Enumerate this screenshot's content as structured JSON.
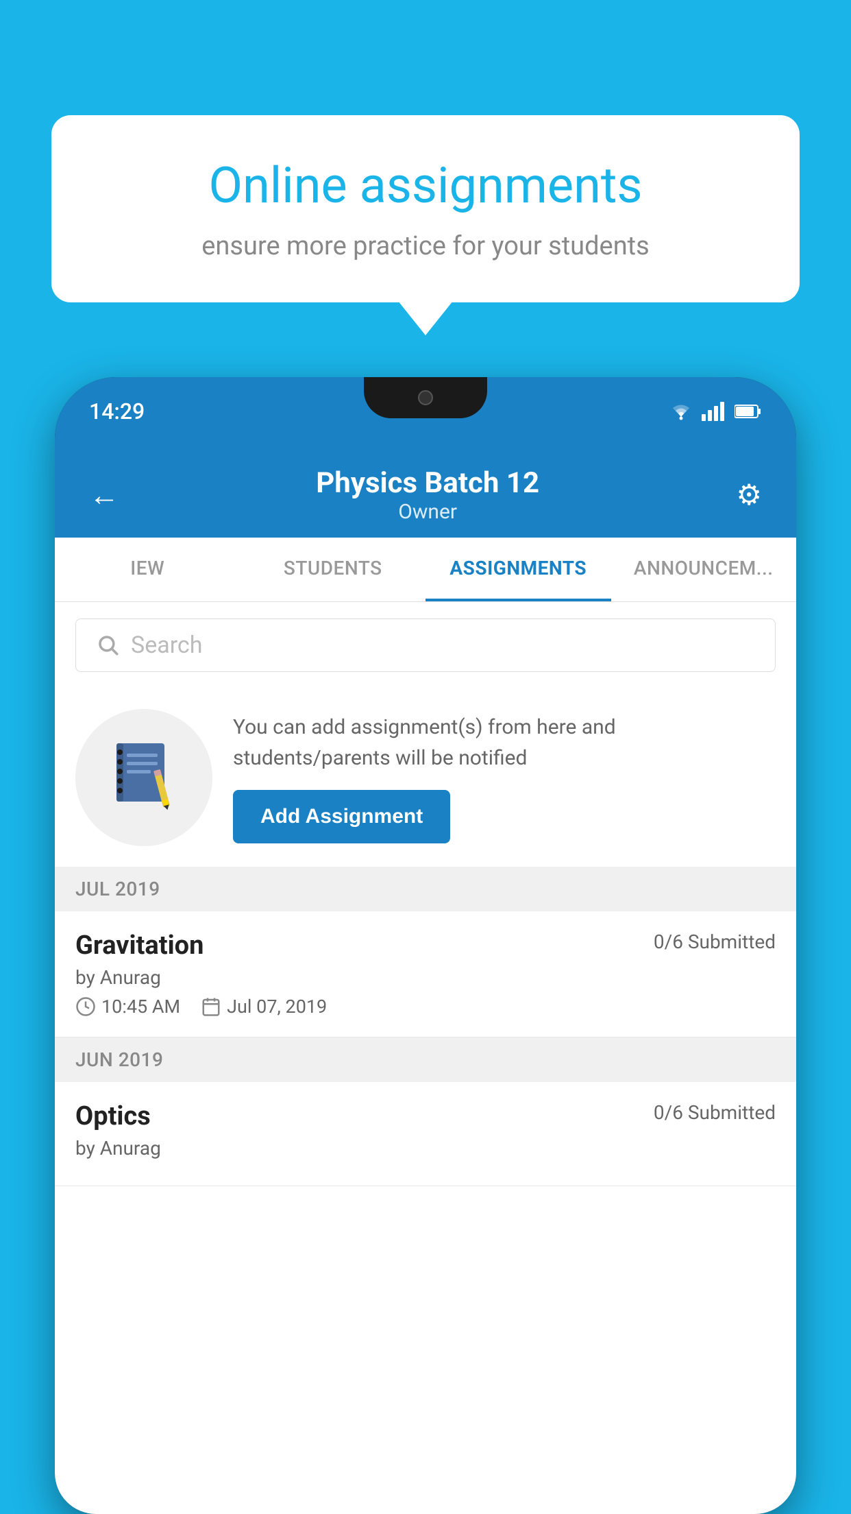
{
  "background_color": "#1ab4e8",
  "speech_bubble": {
    "title": "Online assignments",
    "subtitle": "ensure more practice for your students"
  },
  "phone": {
    "status_bar": {
      "time": "14:29",
      "icons": [
        "wifi",
        "signal",
        "battery"
      ]
    },
    "header": {
      "title": "Physics Batch 12",
      "subtitle": "Owner",
      "back_label": "←",
      "settings_label": "⚙"
    },
    "tabs": [
      {
        "label": "IEW",
        "active": false
      },
      {
        "label": "STUDENTS",
        "active": false
      },
      {
        "label": "ASSIGNMENTS",
        "active": true
      },
      {
        "label": "ANNOUNCEM...",
        "active": false
      }
    ],
    "search": {
      "placeholder": "Search"
    },
    "promo": {
      "description": "You can add assignment(s) from here and students/parents will be notified",
      "button_label": "Add Assignment"
    },
    "sections": [
      {
        "month_label": "JUL 2019",
        "assignments": [
          {
            "title": "Gravitation",
            "status": "0/6 Submitted",
            "author": "by Anurag",
            "time": "10:45 AM",
            "date": "Jul 07, 2019"
          }
        ]
      },
      {
        "month_label": "JUN 2019",
        "assignments": [
          {
            "title": "Optics",
            "status": "0/6 Submitted",
            "author": "by Anurag",
            "time": "",
            "date": ""
          }
        ]
      }
    ]
  }
}
